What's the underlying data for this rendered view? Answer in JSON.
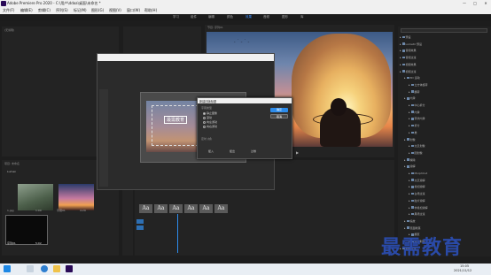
{
  "window": {
    "title": "Adobe Premiere Pro 2020 - C:\\用户\\ddoa\\桌面\\未命名 *",
    "min": "—",
    "max": "□",
    "close": "✕"
  },
  "menu": [
    "文件(F)",
    "编辑(E)",
    "剪辑(C)",
    "序列(S)",
    "标记(M)",
    "图形(G)",
    "视图(V)",
    "窗口(W)",
    "帮助(H)"
  ],
  "workspaces": [
    {
      "label": "学习",
      "active": false
    },
    {
      "label": "组件",
      "active": false
    },
    {
      "label": "编辑",
      "active": false
    },
    {
      "label": "颜色",
      "active": false
    },
    {
      "label": "效果",
      "active": true
    },
    {
      "label": "音频",
      "active": false
    },
    {
      "label": "图形",
      "active": false
    },
    {
      "label": "库",
      "active": false
    }
  ],
  "panels": {
    "source": "(无剪辑)",
    "program": "节目: 序列01",
    "project": "项目: 未命名",
    "project_item": "Lumen"
  },
  "project_items": [
    {
      "label": "1.jpg",
      "meta": "1:00"
    },
    {
      "label": "字幕01",
      "meta": "4:29"
    },
    {
      "label": "序列01",
      "meta": "5:02"
    }
  ],
  "title_canvas_text": "最需教育",
  "new_title_dialog": {
    "title": "新建旧版标题",
    "section": "字幕类型",
    "options": [
      {
        "label": "静止图像",
        "selected": true
      },
      {
        "label": "滚动",
        "selected": false
      },
      {
        "label": "向左游动",
        "selected": false
      },
      {
        "label": "向右游动",
        "selected": false
      }
    ],
    "timing_label": "定时 (帧)",
    "ok": "确定",
    "cancel": "取消",
    "bottom_labels": [
      "缓入",
      "缓出",
      "过卷"
    ]
  },
  "title_styles": [
    "Aa",
    "Aa",
    "Aa",
    "Aa",
    "Aa",
    "Aa"
  ],
  "effects_tree": [
    {
      "label": "预设",
      "level": 0
    },
    {
      "label": "Lumetri 预设",
      "level": 0
    },
    {
      "label": "音频效果",
      "level": 0
    },
    {
      "label": "音频过渡",
      "level": 0
    },
    {
      "label": "视频效果",
      "level": 0
    },
    {
      "label": "视频过渡",
      "level": 0
    },
    {
      "label": "3D 运动",
      "level": 1
    },
    {
      "label": "立方体旋转",
      "level": 2
    },
    {
      "label": "翻转",
      "level": 2
    },
    {
      "label": "内滑",
      "level": 1
    },
    {
      "label": "中心拆分",
      "level": 2
    },
    {
      "label": "内滑",
      "level": 2
    },
    {
      "label": "带状内滑",
      "level": 2
    },
    {
      "label": "拆分",
      "level": 2
    },
    {
      "label": "推",
      "level": 2
    },
    {
      "label": "划像",
      "level": 1
    },
    {
      "label": "交叉划像",
      "level": 2
    },
    {
      "label": "圆划像",
      "level": 2
    },
    {
      "label": "擦除",
      "level": 1
    },
    {
      "label": "溶解",
      "level": 1
    },
    {
      "label": "MorphCut",
      "level": 2
    },
    {
      "label": "交叉溶解",
      "level": 2
    },
    {
      "label": "叠加溶解",
      "level": 2
    },
    {
      "label": "白场过渡",
      "level": 2
    },
    {
      "label": "胶片溶解",
      "level": 2
    },
    {
      "label": "非叠加溶解",
      "level": 2
    },
    {
      "label": "黑场过渡",
      "level": 2
    },
    {
      "label": "缩放",
      "level": 1
    },
    {
      "label": "页面剥落",
      "level": 1
    },
    {
      "label": "翻页",
      "level": 2
    },
    {
      "label": "页面剥落",
      "level": 2
    },
    {
      "label": "视频过渡",
      "level": 0
    }
  ],
  "taskbar": {
    "time": "15:05",
    "date": "2021/11/12"
  },
  "watermark": "最需教育",
  "colors": {
    "accent": "#2d8ceb",
    "panel": "#232323"
  }
}
